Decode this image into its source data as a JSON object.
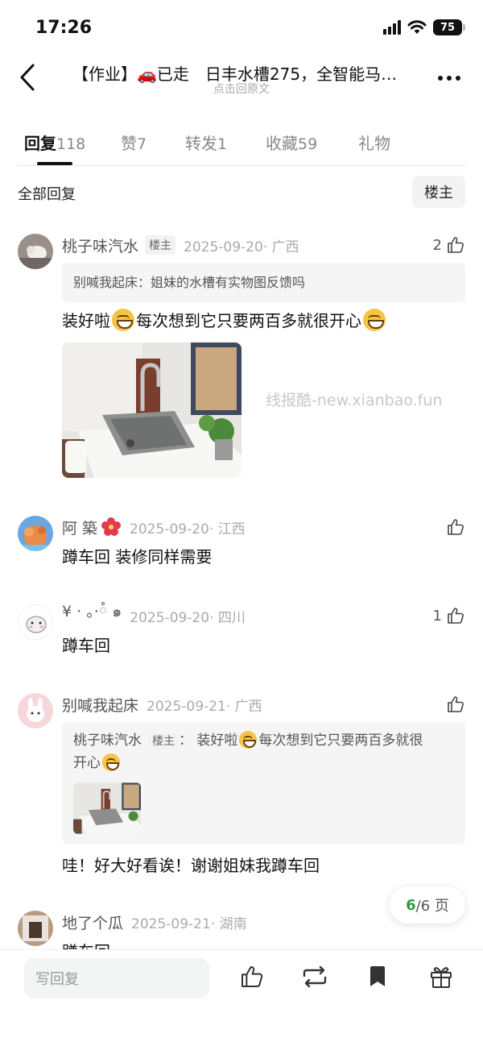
{
  "status": {
    "time": "17:26",
    "battery": "75"
  },
  "nav": {
    "title": "【作业】🚗已走　日丰水槽275，全智能马…",
    "subtitle": "点击回原文"
  },
  "tabs": [
    {
      "label": "回复",
      "count": "118"
    },
    {
      "label": "赞",
      "count": "7"
    },
    {
      "label": "转发",
      "count": "1"
    },
    {
      "label": "收藏",
      "count": "59"
    },
    {
      "label": "礼物",
      "count": ""
    }
  ],
  "filter": {
    "label": "全部回复",
    "owner_button": "楼主"
  },
  "comments": [
    {
      "name": "桃子味汽水",
      "badge": "楼主",
      "date": "2025-09-20· 广西",
      "likes": "2",
      "quote": "别喊我起床：姐妹的水槽有实物图反馈吗",
      "text_part1": "装好啦",
      "text_part2": "每次想到它只要两百多就很开心"
    },
    {
      "name": "阿 築",
      "date": "2025-09-20· 江西",
      "likes": "",
      "text": "蹲车回 装修同样需要"
    },
    {
      "name": "¥ · 。·ཾ ๑",
      "date": "2025-09-20· 四川",
      "likes": "1",
      "text": "蹲车回"
    },
    {
      "name": "别喊我起床",
      "date": "2025-09-21· 广西",
      "likes": "",
      "quote_name": "桃子味汽水",
      "quote_badge": "楼主",
      "quote_text1": "：  装好啦",
      "quote_text2": "每次想到它只要两百多就很",
      "quote_text3": "开心",
      "text": "哇！好大好看诶！谢谢姐妹我蹲车回"
    },
    {
      "name": "地了个瓜",
      "date": "2025-09-21· 湖南",
      "likes": "",
      "text": "蹲车回"
    }
  ],
  "watermark": "线报酷-new.xianbao.fun",
  "pagination": {
    "current": "6",
    "total": "/6 页"
  },
  "bottom": {
    "reply_placeholder": "写回复"
  },
  "colors": {
    "accent_green": "#2e9b3c",
    "text": "#111111",
    "muted": "#aaaaaa"
  },
  "icons": [
    "back-arrow-icon",
    "more-dots-icon",
    "thumbs-up-icon",
    "repost-icon",
    "bookmark-icon",
    "gift-icon",
    "flower-emoji-icon",
    "grin-emoji-icon"
  ]
}
